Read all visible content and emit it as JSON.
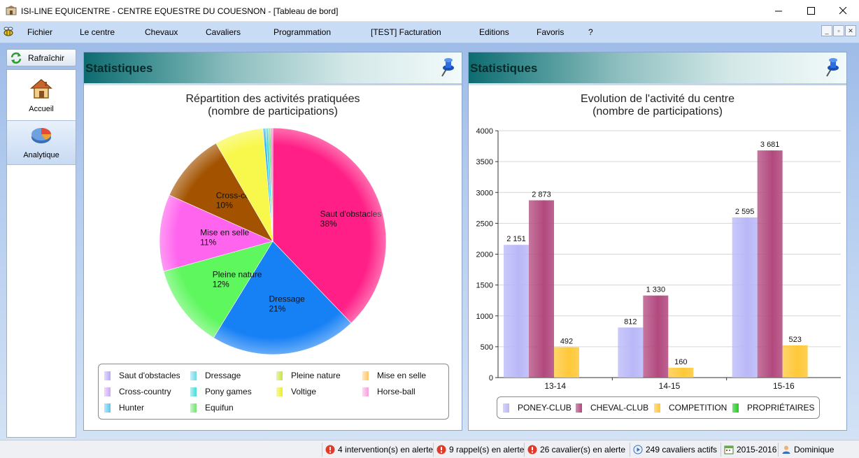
{
  "window": {
    "title": "ISI-LINE EQUICENTRE - CENTRE EQUESTRE DU COUESNON - [Tableau de bord]"
  },
  "menu": {
    "items": [
      "Fichier",
      "Le centre",
      "Chevaux",
      "Cavaliers",
      "Programmation",
      "[TEST] Facturation",
      "Editions",
      "Favoris",
      "?"
    ]
  },
  "sidebar": {
    "refresh_label": "Rafraîchir",
    "items": [
      {
        "label": "Accueil",
        "icon": "house-icon"
      },
      {
        "label": "Analytique",
        "icon": "pie-chart-icon"
      }
    ]
  },
  "panels": {
    "left": {
      "header": "Statistiques"
    },
    "right": {
      "header": "Statistiques"
    }
  },
  "colors": {
    "header_start": "#0d6b70",
    "menu_bar": "#c9dcf6",
    "workspace": "#b5cdef"
  },
  "chart_data": [
    {
      "type": "pie",
      "title": "Répartition des activités pratiquées",
      "subtitle": "(nombre de participations)",
      "slices": [
        {
          "label": "Saut d'obstacles",
          "percent": 38,
          "color": "#ff1f86",
          "show_label": true
        },
        {
          "label": "Dressage",
          "percent": 21,
          "color": "#1680f5",
          "show_label": true
        },
        {
          "label": "Pleine nature",
          "percent": 12,
          "color": "#5ef75e",
          "show_label": true
        },
        {
          "label": "Mise en selle",
          "percent": 11,
          "color": "#ff64ee",
          "show_label": true
        },
        {
          "label": "Cross-country",
          "percent": 10,
          "color": "#a35300",
          "show_label": true
        },
        {
          "label": "Voltige",
          "percent": 7,
          "color": "#f8f84c",
          "show_label": false
        },
        {
          "label": "Hunter",
          "percent": 0.4,
          "color": "#3fb7f5",
          "show_label": false
        },
        {
          "label": "Pony games",
          "percent": 0.4,
          "color": "#4ad9d9",
          "show_label": false
        },
        {
          "label": "Equifun",
          "percent": 0.3,
          "color": "#6fe06f",
          "show_label": false
        },
        {
          "label": "Horse-ball",
          "percent": 0.3,
          "color": "#f07fd2",
          "show_label": false
        }
      ],
      "legend": [
        {
          "label": "Saut d'obstacles",
          "color": "#b9a8f8"
        },
        {
          "label": "Dressage",
          "color": "#6fd8e8"
        },
        {
          "label": "Pleine nature",
          "color": "#c6e63c"
        },
        {
          "label": "Mise en selle",
          "color": "#ffc766"
        },
        {
          "label": "Cross-country",
          "color": "#cfa6f8"
        },
        {
          "label": "Pony games",
          "color": "#4ad9d9"
        },
        {
          "label": "Voltige",
          "color": "#eded28"
        },
        {
          "label": "Horse-ball",
          "color": "#f4a1d9"
        },
        {
          "label": "Hunter",
          "color": "#5bc6ee"
        },
        {
          "label": "Equifun",
          "color": "#74e274"
        }
      ]
    },
    {
      "type": "bar",
      "title": "Evolution de l'activité du centre",
      "subtitle": "(nombre de participations)",
      "categories": [
        "13-14",
        "14-15",
        "15-16"
      ],
      "ylim": [
        0,
        4000
      ],
      "yticks": [
        0,
        500,
        1000,
        1500,
        2000,
        2500,
        3000,
        3500,
        4000
      ],
      "grid": true,
      "series": [
        {
          "name": "PONEY-CLUB",
          "values": [
            2151,
            812,
            2595
          ],
          "labels": [
            "2 151",
            "812",
            "2 595"
          ],
          "color": "#b9b8f8"
        },
        {
          "name": "CHEVAL-CLUB",
          "values": [
            2873,
            1330,
            3681
          ],
          "labels": [
            "2 873",
            "1 330",
            "3 681"
          ],
          "color": "#b2497e"
        },
        {
          "name": "COMPETITION",
          "values": [
            492,
            160,
            523
          ],
          "labels": [
            "492",
            "160",
            "523"
          ],
          "color": "#ffc838"
        },
        {
          "name": "PROPRIÉTAIRES",
          "values": [
            0,
            0,
            0
          ],
          "labels": [
            "",
            "",
            ""
          ],
          "color": "#22cc22"
        }
      ]
    }
  ],
  "status": {
    "interventions": "4 intervention(s) en alerte",
    "rappels": "9 rappel(s) en alerte",
    "cavaliers_alert": "26 cavalier(s) en alerte",
    "active": "249 cavaliers actifs",
    "season": "2015-2016",
    "user": "Dominique"
  }
}
